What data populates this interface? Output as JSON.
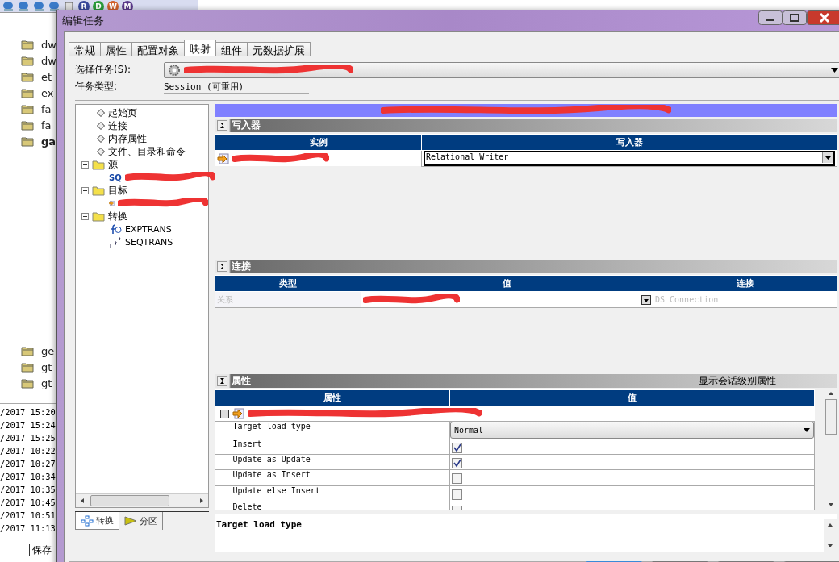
{
  "background_app": {
    "toolbar_badges": [
      {
        "letter": "R",
        "color": "#3a4a9a"
      },
      {
        "letter": "D",
        "color": "#2a9a3a"
      },
      {
        "letter": "W",
        "color": "#d0602a"
      },
      {
        "letter": "M",
        "color": "#5a3a8a"
      }
    ],
    "tree_items": [
      {
        "label": "dw",
        "bold": false
      },
      {
        "label": "dw",
        "bold": false
      },
      {
        "label": "et",
        "bold": false
      },
      {
        "label": "ex",
        "bold": false
      },
      {
        "label": "fa",
        "bold": false
      },
      {
        "label": "fa",
        "bold": false
      },
      {
        "label": "ga",
        "bold": true
      }
    ],
    "tree_items_lower": [
      {
        "label": "ge",
        "bold": false
      },
      {
        "label": "gt",
        "bold": false
      },
      {
        "label": "gt",
        "bold": false
      }
    ],
    "timestamps": [
      "/2017 15:20",
      "/2017 15:24",
      "/2017 15:25",
      "/2017 10:22",
      "/2017 10:27",
      "/2017 10:34",
      "/2017 10:35",
      "/2017 10:45",
      "/2017 10:51",
      "/2017 11:13"
    ],
    "bottom_tab": "保存"
  },
  "window": {
    "title": "编辑任务"
  },
  "tabs": [
    {
      "label": "常规",
      "selected": false
    },
    {
      "label": "属性",
      "selected": false
    },
    {
      "label": "配置对象",
      "selected": false
    },
    {
      "label": "映射",
      "selected": true
    },
    {
      "label": "组件",
      "selected": false
    },
    {
      "label": "元数据扩展",
      "selected": false
    }
  ],
  "select_task": {
    "label": "选择任务(S):",
    "redacted": true
  },
  "task_type": {
    "label": "任务类型:",
    "value": "Session (可重用)"
  },
  "tree": [
    {
      "kind": "page",
      "label": "起始页"
    },
    {
      "kind": "page",
      "label": "连接"
    },
    {
      "kind": "page",
      "label": "内存属性"
    },
    {
      "kind": "page",
      "label": "文件、目录和命令"
    },
    {
      "kind": "folder",
      "label": "源",
      "expanded": true,
      "children": [
        {
          "kind": "source",
          "icon_text": "SQ",
          "redacted": true
        }
      ]
    },
    {
      "kind": "folder",
      "label": "目标",
      "expanded": true,
      "children": [
        {
          "kind": "target",
          "redacted": true
        }
      ]
    },
    {
      "kind": "folder",
      "label": "转换",
      "expanded": true,
      "children": [
        {
          "kind": "expression",
          "label": "EXPTRANS"
        },
        {
          "kind": "sequence",
          "label": "SEQTRANS"
        }
      ]
    }
  ],
  "left_tabs": [
    {
      "label": "转换",
      "selected": true
    },
    {
      "label": "分区",
      "selected": false
    }
  ],
  "writers": {
    "title": "写入器",
    "columns": [
      "实例",
      "写入器"
    ],
    "rows": [
      {
        "instance_redacted": true,
        "writer": "Relational Writer"
      }
    ]
  },
  "connections": {
    "title": "连接",
    "columns": [
      "类型",
      "值",
      "连接"
    ],
    "rows": [
      {
        "type": "关系",
        "value_redacted": true,
        "connection": "DS Connection"
      }
    ]
  },
  "properties": {
    "title": "属性",
    "link": "显示会话级别属性",
    "columns": [
      "属性",
      "值"
    ],
    "group": {
      "expanded": true,
      "redacted": true
    },
    "rows": [
      {
        "kind": "dropdown",
        "name": "Target load type",
        "value": "Normal"
      },
      {
        "kind": "checkbox",
        "name": "Insert",
        "checked": true
      },
      {
        "kind": "checkbox",
        "name": "Update as Update",
        "checked": true
      },
      {
        "kind": "checkbox",
        "name": "Update as Insert",
        "checked": false
      },
      {
        "kind": "checkbox",
        "name": "Update else Insert",
        "checked": false
      },
      {
        "kind": "checkbox",
        "name": "Delete",
        "checked": false
      }
    ]
  },
  "description": {
    "title": "Target load type"
  }
}
